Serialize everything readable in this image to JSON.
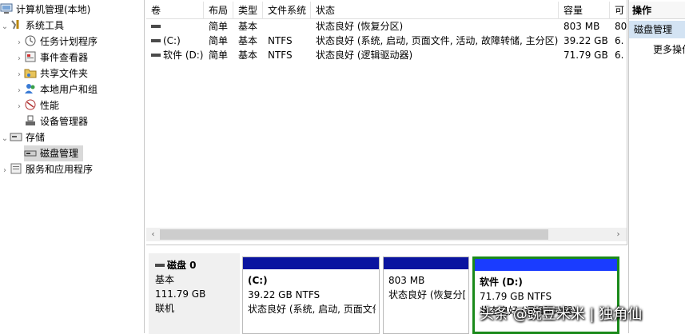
{
  "tree": {
    "items": [
      {
        "label": "计算机管理(本地)",
        "icon": "computer-management-icon",
        "arrow": ""
      },
      {
        "label": "系统工具",
        "icon": "system-tools-icon",
        "arrow": "⌄"
      },
      {
        "label": "任务计划程序",
        "icon": "task-scheduler-icon",
        "arrow": "›"
      },
      {
        "label": "事件查看器",
        "icon": "event-viewer-icon",
        "arrow": "›"
      },
      {
        "label": "共享文件夹",
        "icon": "shared-folders-icon",
        "arrow": "›"
      },
      {
        "label": "本地用户和组",
        "icon": "local-users-icon",
        "arrow": "›"
      },
      {
        "label": "性能",
        "icon": "performance-icon",
        "arrow": "›"
      },
      {
        "label": "设备管理器",
        "icon": "device-manager-icon",
        "arrow": ""
      },
      {
        "label": "存储",
        "icon": "storage-icon",
        "arrow": "⌄"
      },
      {
        "label": "磁盘管理",
        "icon": "disk-management-icon",
        "arrow": ""
      },
      {
        "label": "服务和应用程序",
        "icon": "services-apps-icon",
        "arrow": "›"
      }
    ]
  },
  "volumes": {
    "columns": [
      "卷",
      "布局",
      "类型",
      "文件系统",
      "状态",
      "容量",
      "可"
    ],
    "rows": [
      {
        "volume": "",
        "layout": "简单",
        "type": "基本",
        "fs": "",
        "status": "状态良好 (恢复分区)",
        "capacity": "803 MB",
        "free": "80"
      },
      {
        "volume": "(C:)",
        "layout": "简单",
        "type": "基本",
        "fs": "NTFS",
        "status": "状态良好 (系统, 启动, 页面文件, 活动, 故障转储, 主分区)",
        "capacity": "39.22 GB",
        "free": "6."
      },
      {
        "volume": "软件 (D:)",
        "layout": "简单",
        "type": "基本",
        "fs": "NTFS",
        "status": "状态良好 (逻辑驱动器)",
        "capacity": "71.79 GB",
        "free": "6."
      }
    ]
  },
  "disk": {
    "name": "磁盘 0",
    "type": "基本",
    "size": "111.79 GB",
    "state": "联机",
    "partitions": [
      {
        "name": "(C:)",
        "size_fs": "39.22 GB NTFS",
        "status": "状态良好 (系统, 启动, 页面文件"
      },
      {
        "name": "",
        "size_fs": "803 MB",
        "status": "状态良好 (恢复分["
      },
      {
        "name": "软件  (D:)",
        "size_fs": "71.79 GB NTFS",
        "status": "状态良好 (逻辑驱动器)"
      }
    ]
  },
  "actions": {
    "header": "操作",
    "section": "磁盘管理",
    "more": "更多操作"
  },
  "watermark": "头条 @豌豆米米 | 独角仙",
  "colors": {
    "partition_stripe": "#0a14a0",
    "selected_border": "#1a8a1a",
    "selected_stripe": "#1a3cff",
    "action_selected": "#d3e3f3"
  }
}
